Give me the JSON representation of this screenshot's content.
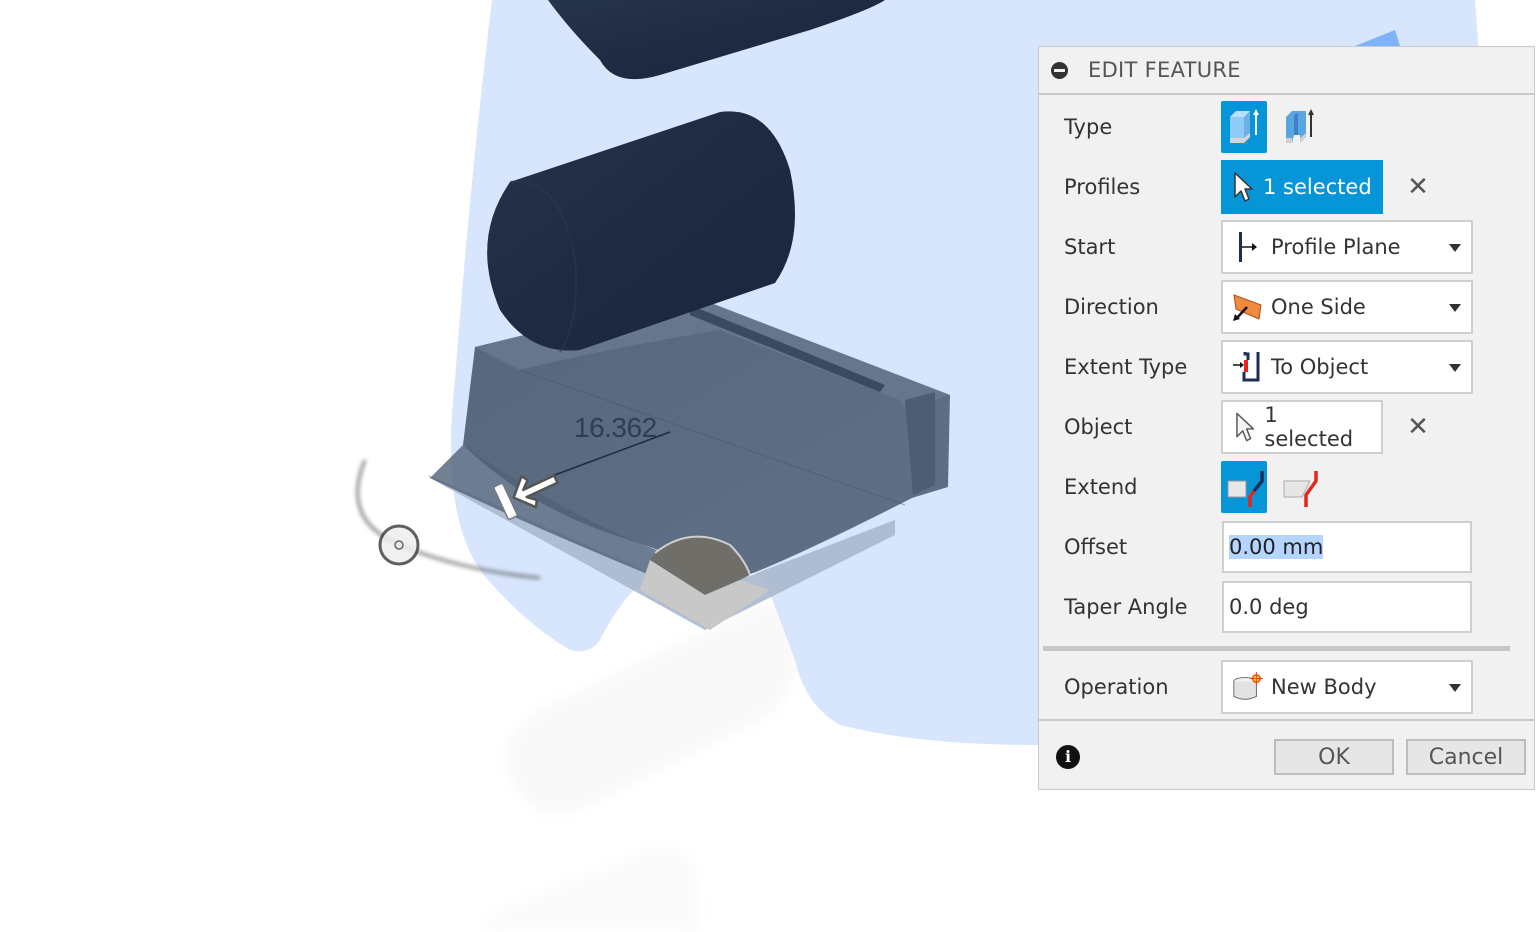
{
  "viewport": {
    "dimension_value": "16.362",
    "colors": {
      "preview_plane": "#d7e6fd",
      "cylinder": "#1e2a40",
      "body": "#5b6b80",
      "ground_shadow": "#c8c8c8"
    }
  },
  "panel": {
    "title": "EDIT FEATURE",
    "accent_color": "#0696d7",
    "rows": {
      "type": {
        "label": "Type",
        "options": [
          "solid-extrude-icon",
          "thin-extrude-icon"
        ],
        "selected": 0
      },
      "profiles": {
        "label": "Profiles",
        "value": "1 selected"
      },
      "start": {
        "label": "Start",
        "value": "Profile Plane"
      },
      "direction": {
        "label": "Direction",
        "value": "One Side"
      },
      "extent_type": {
        "label": "Extent Type",
        "value": "To Object"
      },
      "object": {
        "label": "Object",
        "value": "1 selected"
      },
      "extend": {
        "label": "Extend",
        "options": [
          "extend-adjacent-faces-icon",
          "extend-surface-icon"
        ],
        "selected": 0
      },
      "offset": {
        "label": "Offset",
        "value": "0.00 mm"
      },
      "taper_angle": {
        "label": "Taper Angle",
        "value": "0.0 deg"
      },
      "operation": {
        "label": "Operation",
        "value": "New Body"
      }
    },
    "clear_symbol": "✕",
    "info_symbol": "i",
    "ok_label": "OK",
    "cancel_label": "Cancel"
  }
}
